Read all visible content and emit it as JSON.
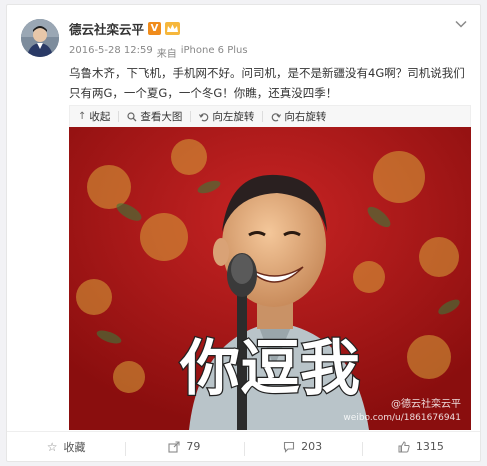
{
  "post": {
    "username": "德云社栾云平",
    "verified_badge": "V",
    "timestamp": "2016-5-28 12:59",
    "source_prefix": "来自",
    "device": "iPhone 6 Plus",
    "text": "乌鲁木齐，下飞机，手机网不好。问司机，是不是新疆没有4G啊？司机说我们只有两G，一个夏G，一个冬G！你瞧，还真没四季！"
  },
  "media_toolbar": {
    "collapse_label": "收起",
    "view_large_label": "查看大图",
    "rotate_left_label": "向左旋转",
    "rotate_right_label": "向右旋转"
  },
  "image": {
    "caption": "你逗我",
    "watermark_line1": "@德云社栾云平",
    "watermark_line2": "weibo.com/u/1861676941"
  },
  "actions": {
    "favorite_label": "收藏",
    "repost_count": "79",
    "comment_count": "203",
    "like_count": "1315"
  },
  "colors": {
    "accent_orange": "#f08c1c",
    "curtain_red": "#b01818"
  },
  "icons": {
    "expand": "chevron-down-icon",
    "collapse": "arrow-up-icon",
    "view_large": "magnifier-icon",
    "rotate_left": "rotate-left-icon",
    "rotate_right": "rotate-right-icon",
    "favorite": "star-icon",
    "repost": "share-icon",
    "comment": "comment-icon",
    "like": "thumbs-up-icon"
  }
}
